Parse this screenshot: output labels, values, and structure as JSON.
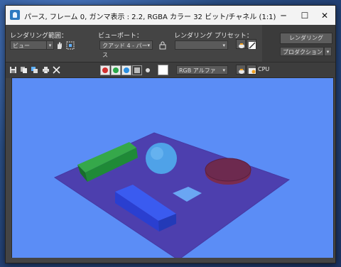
{
  "window": {
    "title": "パース, フレーム 0, ガンマ表示 : 2.2, RGBA カラー 32 ビット/チャネル (1:1)",
    "controls": {
      "minimize": "─",
      "maximize": "☐",
      "close": "✕"
    }
  },
  "toolbar": {
    "area_label": "レンダリング範囲：",
    "area_value": "ビュー",
    "viewport_label": "ビューポート：",
    "viewport_value": "クアッド 4 - パース",
    "preset_label": "レンダリング プリセット：",
    "preset_value": "",
    "render_button": "レンダリング",
    "mode_value": "プロダクション"
  },
  "display_bar": {
    "channel_value": "RGB アルファ",
    "cpu_label": "CPU",
    "colors": {
      "red": "#d23030",
      "green": "#2aa84a",
      "blue": "#2b8fe0"
    }
  },
  "icons": [
    "save-icon",
    "copy-icon",
    "clone-icon",
    "print-icon",
    "clear-icon",
    "lock-icon",
    "teapot-icon",
    "environment-icon"
  ]
}
